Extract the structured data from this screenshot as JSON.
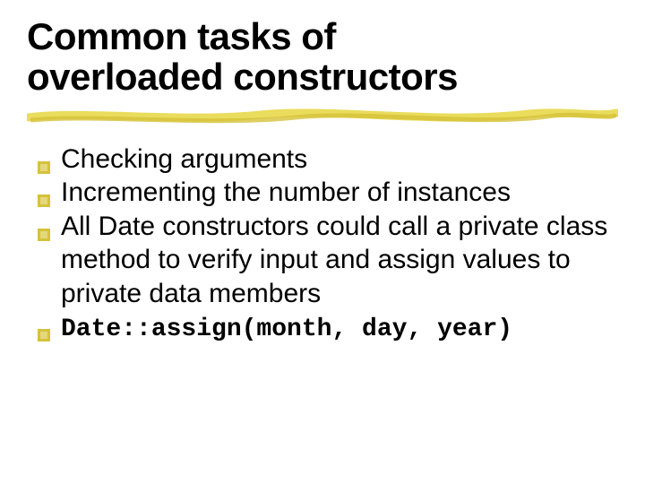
{
  "title_line1": "Common tasks of",
  "title_line2": "overloaded constructors",
  "bullets": [
    {
      "text": "Checking arguments",
      "code": false
    },
    {
      "text": "Incrementing the number of instances",
      "code": false
    },
    {
      "text": "All Date constructors could call a private class method to verify input and assign values to private data members",
      "code": false
    },
    {
      "text": "Date::assign(month, day, year)",
      "code": true
    }
  ]
}
